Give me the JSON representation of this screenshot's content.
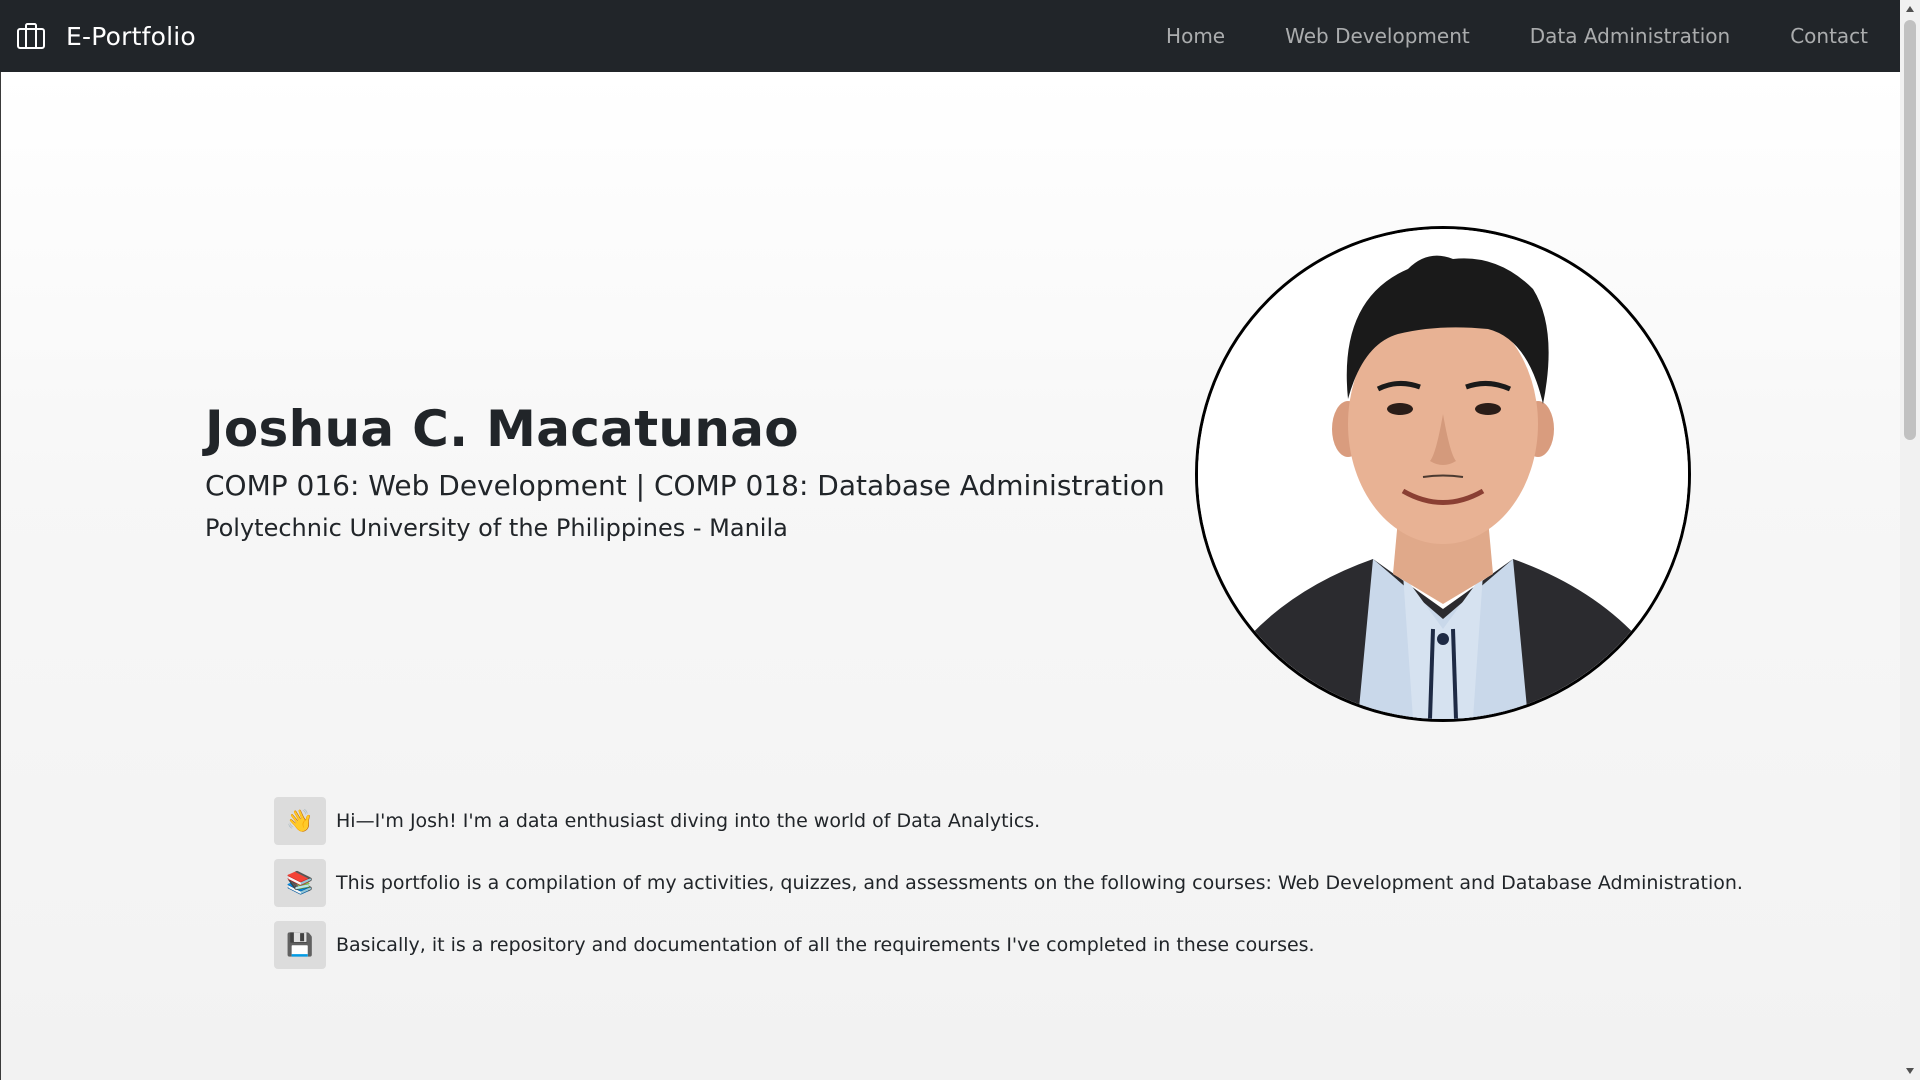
{
  "navbar": {
    "brand_icon": "briefcase-icon",
    "brand": "E-Portfolio",
    "links": [
      {
        "label": "Home"
      },
      {
        "label": "Web Development"
      },
      {
        "label": "Data Administration"
      },
      {
        "label": "Contact"
      }
    ],
    "background": "#212529"
  },
  "hero": {
    "name": "Joshua C. Macatunao",
    "courses": "COMP 016: Web Development | COMP 018: Database Administration",
    "school": "Polytechnic University of the Philippines - Manila",
    "portrait_icon": "profile-photo"
  },
  "intro": [
    {
      "icon": "waving-hand-icon",
      "glyph": "👋",
      "text": "Hi—I'm Josh! I'm a data enthusiast diving into the world of Data Analytics."
    },
    {
      "icon": "books-icon",
      "glyph": "📚",
      "text": "This portfolio is a compilation of my activities, quizzes, and assessments on the following courses: Web Development and Database Administration."
    },
    {
      "icon": "floppy-disk-icon",
      "glyph": "💾",
      "text": "Basically, it is a repository and documentation of all the requirements I've completed in these courses."
    }
  ]
}
